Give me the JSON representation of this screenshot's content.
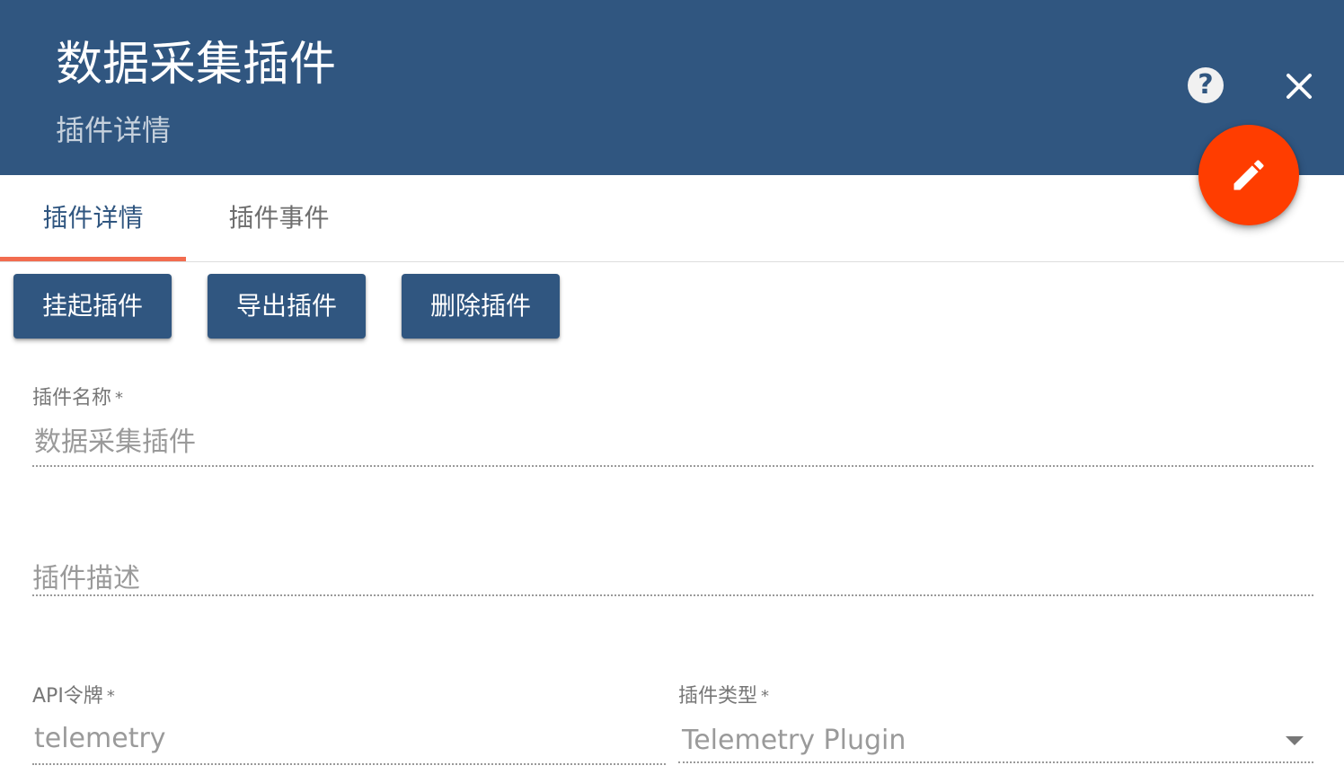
{
  "header": {
    "title": "数据采集插件",
    "subtitle": "插件详情",
    "help_icon_glyph": "?"
  },
  "tabs": [
    {
      "label": "插件详情",
      "active": true
    },
    {
      "label": "插件事件",
      "active": false
    }
  ],
  "actions": {
    "suspend_label": "挂起插件",
    "export_label": "导出插件",
    "delete_label": "删除插件"
  },
  "form": {
    "name": {
      "label": "插件名称",
      "required_mark": "*",
      "value": "数据采集插件"
    },
    "description": {
      "placeholder": "插件描述"
    },
    "api_token": {
      "label": "API令牌",
      "required_mark": "*",
      "value": "telemetry"
    },
    "plugin_type": {
      "label": "插件类型",
      "required_mark": "*",
      "value": "Telemetry Plugin"
    }
  },
  "colors": {
    "header_bg": "#305680",
    "accent": "#ff3d00",
    "tab_indicator": "#f26c4f",
    "button_bg": "#305680"
  },
  "icons": {
    "help": "help-circle-icon",
    "close": "close-icon",
    "edit": "pencil-icon",
    "dropdown": "caret-down-icon"
  }
}
